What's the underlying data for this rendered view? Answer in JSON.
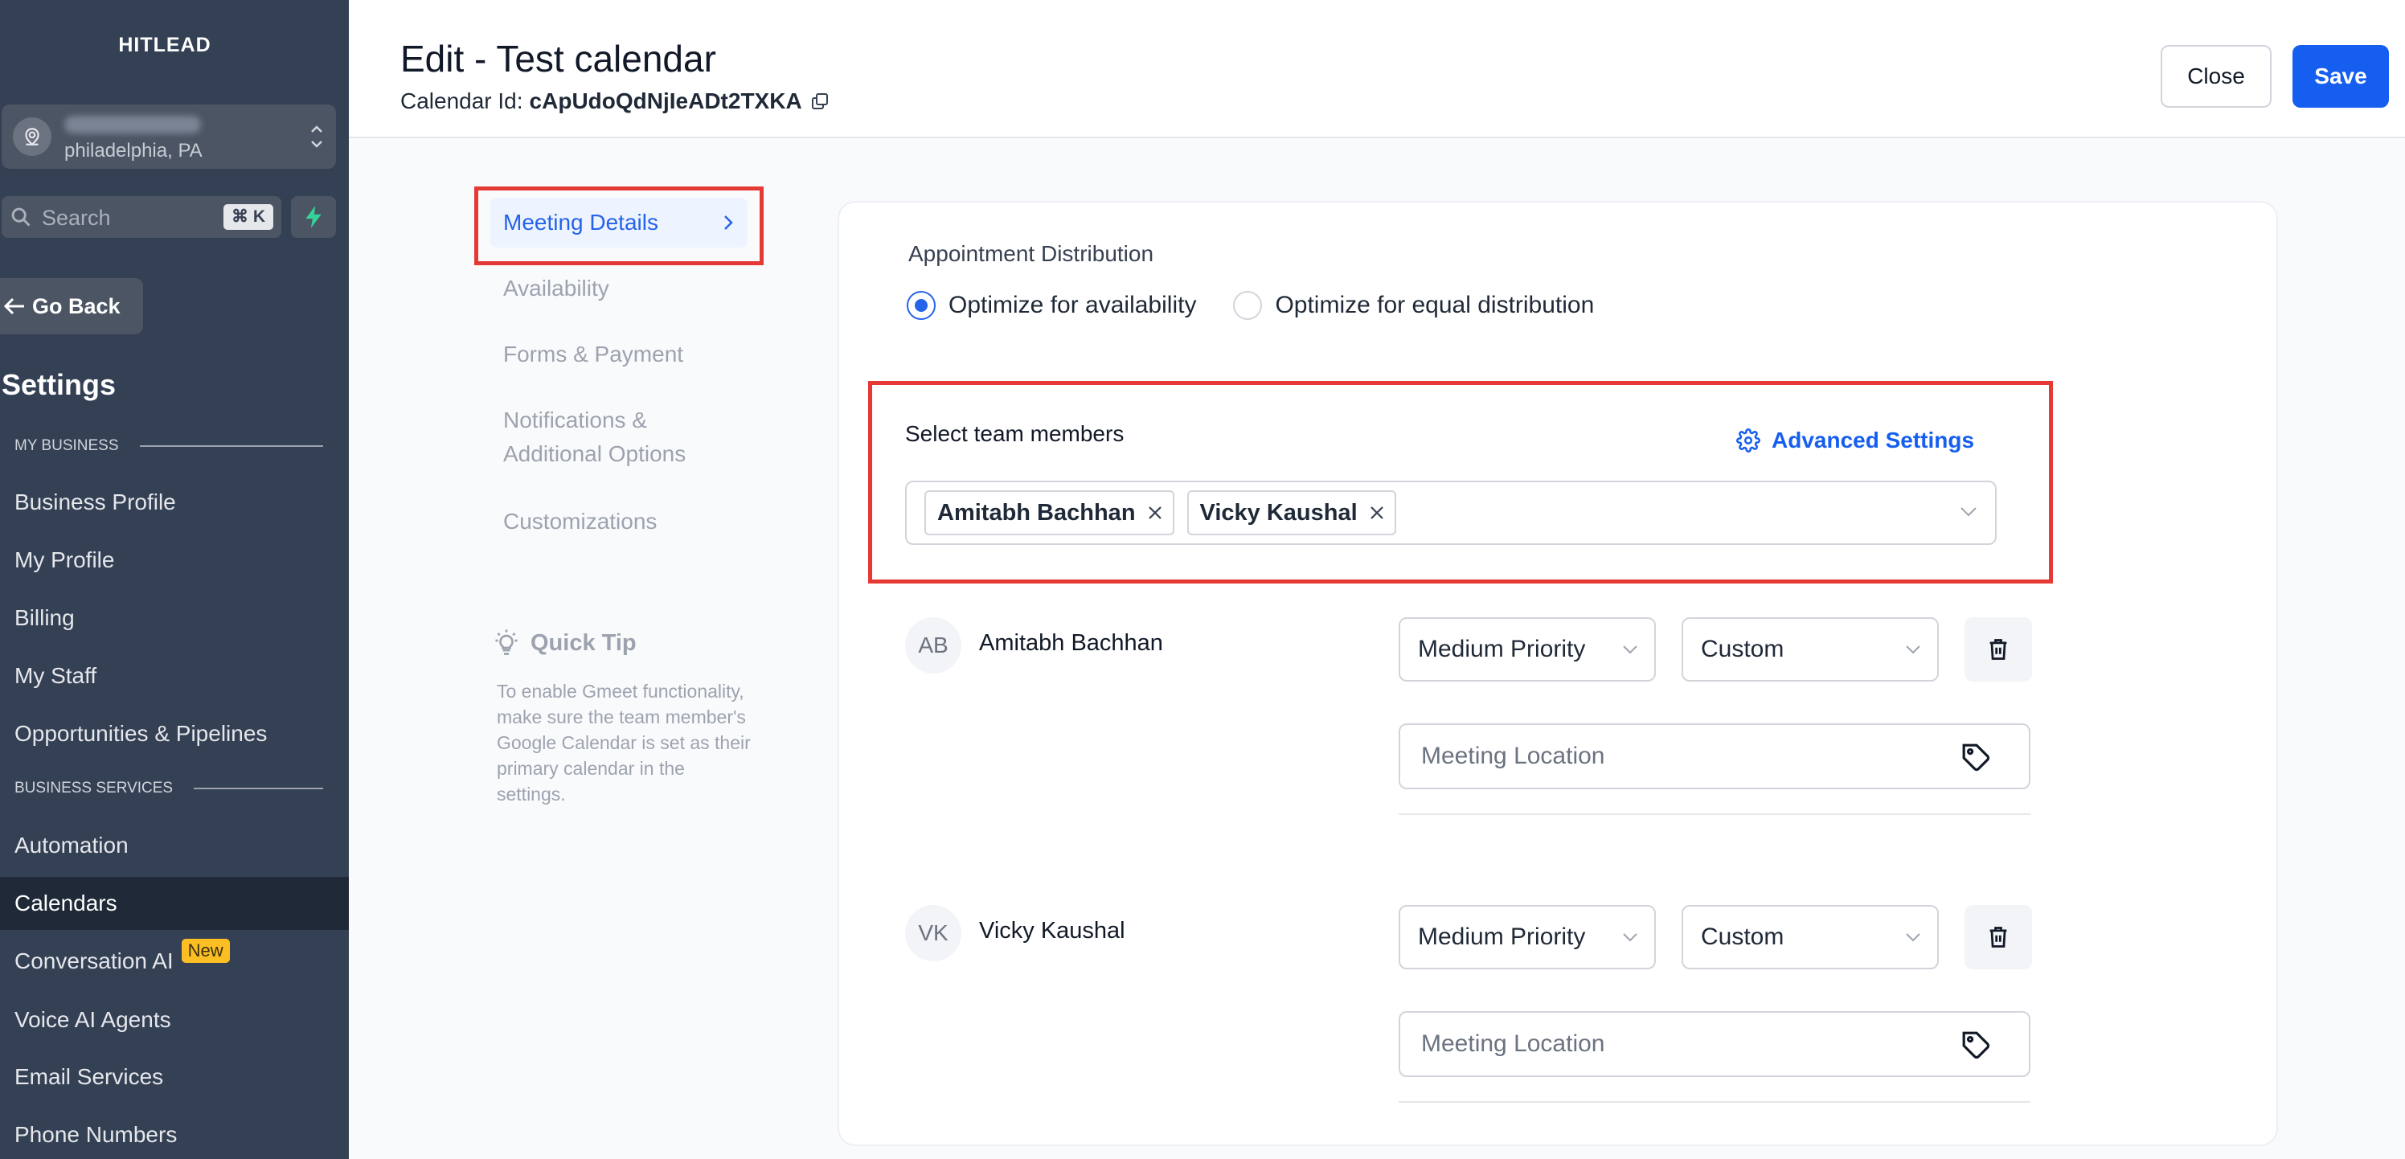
{
  "sidebar": {
    "brand": "HITLEAD",
    "location": {
      "city": "philadelphia, PA"
    },
    "search": {
      "placeholder": "Search",
      "shortcut": "⌘ K"
    },
    "go_back": "Go Back",
    "title": "Settings",
    "sections": [
      {
        "label": "MY BUSINESS",
        "items": [
          "Business Profile",
          "My Profile",
          "Billing",
          "My Staff",
          "Opportunities & Pipelines"
        ]
      },
      {
        "label": "BUSINESS SERVICES",
        "items": [
          "Automation",
          "Calendars",
          "Conversation AI",
          "Voice AI Agents",
          "Email Services",
          "Phone Numbers"
        ]
      }
    ],
    "active_item": "Calendars",
    "new_badge": "New"
  },
  "header": {
    "title": "Edit - Test calendar",
    "calendar_id_label": "Calendar Id:",
    "calendar_id": "cApUdoQdNjIeADt2TXKA",
    "close_label": "Close",
    "save_label": "Save"
  },
  "subnav": {
    "items": [
      "Meeting Details",
      "Availability",
      "Forms & Payment",
      "Notifications & Additional Options",
      "Customizations"
    ],
    "active": "Meeting Details"
  },
  "quick_tip": {
    "title": "Quick Tip",
    "body": "To enable Gmeet functionality, make sure the team member's Google Calendar is set as their primary calendar in the settings."
  },
  "distribution": {
    "title": "Appointment Distribution",
    "options": [
      "Optimize for availability",
      "Optimize for equal distribution"
    ],
    "selected": "Optimize for availability"
  },
  "team": {
    "label": "Select team members",
    "advanced_settings": "Advanced Settings",
    "selected_members": [
      "Amitabh Bachhan",
      "Vicky Kaushal"
    ],
    "members": [
      {
        "initials": "AB",
        "name": "Amitabh Bachhan",
        "priority": "Medium Priority",
        "mode": "Custom",
        "location_placeholder": "Meeting Location"
      },
      {
        "initials": "VK",
        "name": "Vicky Kaushal",
        "priority": "Medium Priority",
        "mode": "Custom",
        "location_placeholder": "Meeting Location"
      }
    ]
  },
  "colors": {
    "sidebar_bg": "#344054",
    "primary": "#155eef",
    "highlight": "#e53935",
    "new_badge": "#fbbf24"
  }
}
